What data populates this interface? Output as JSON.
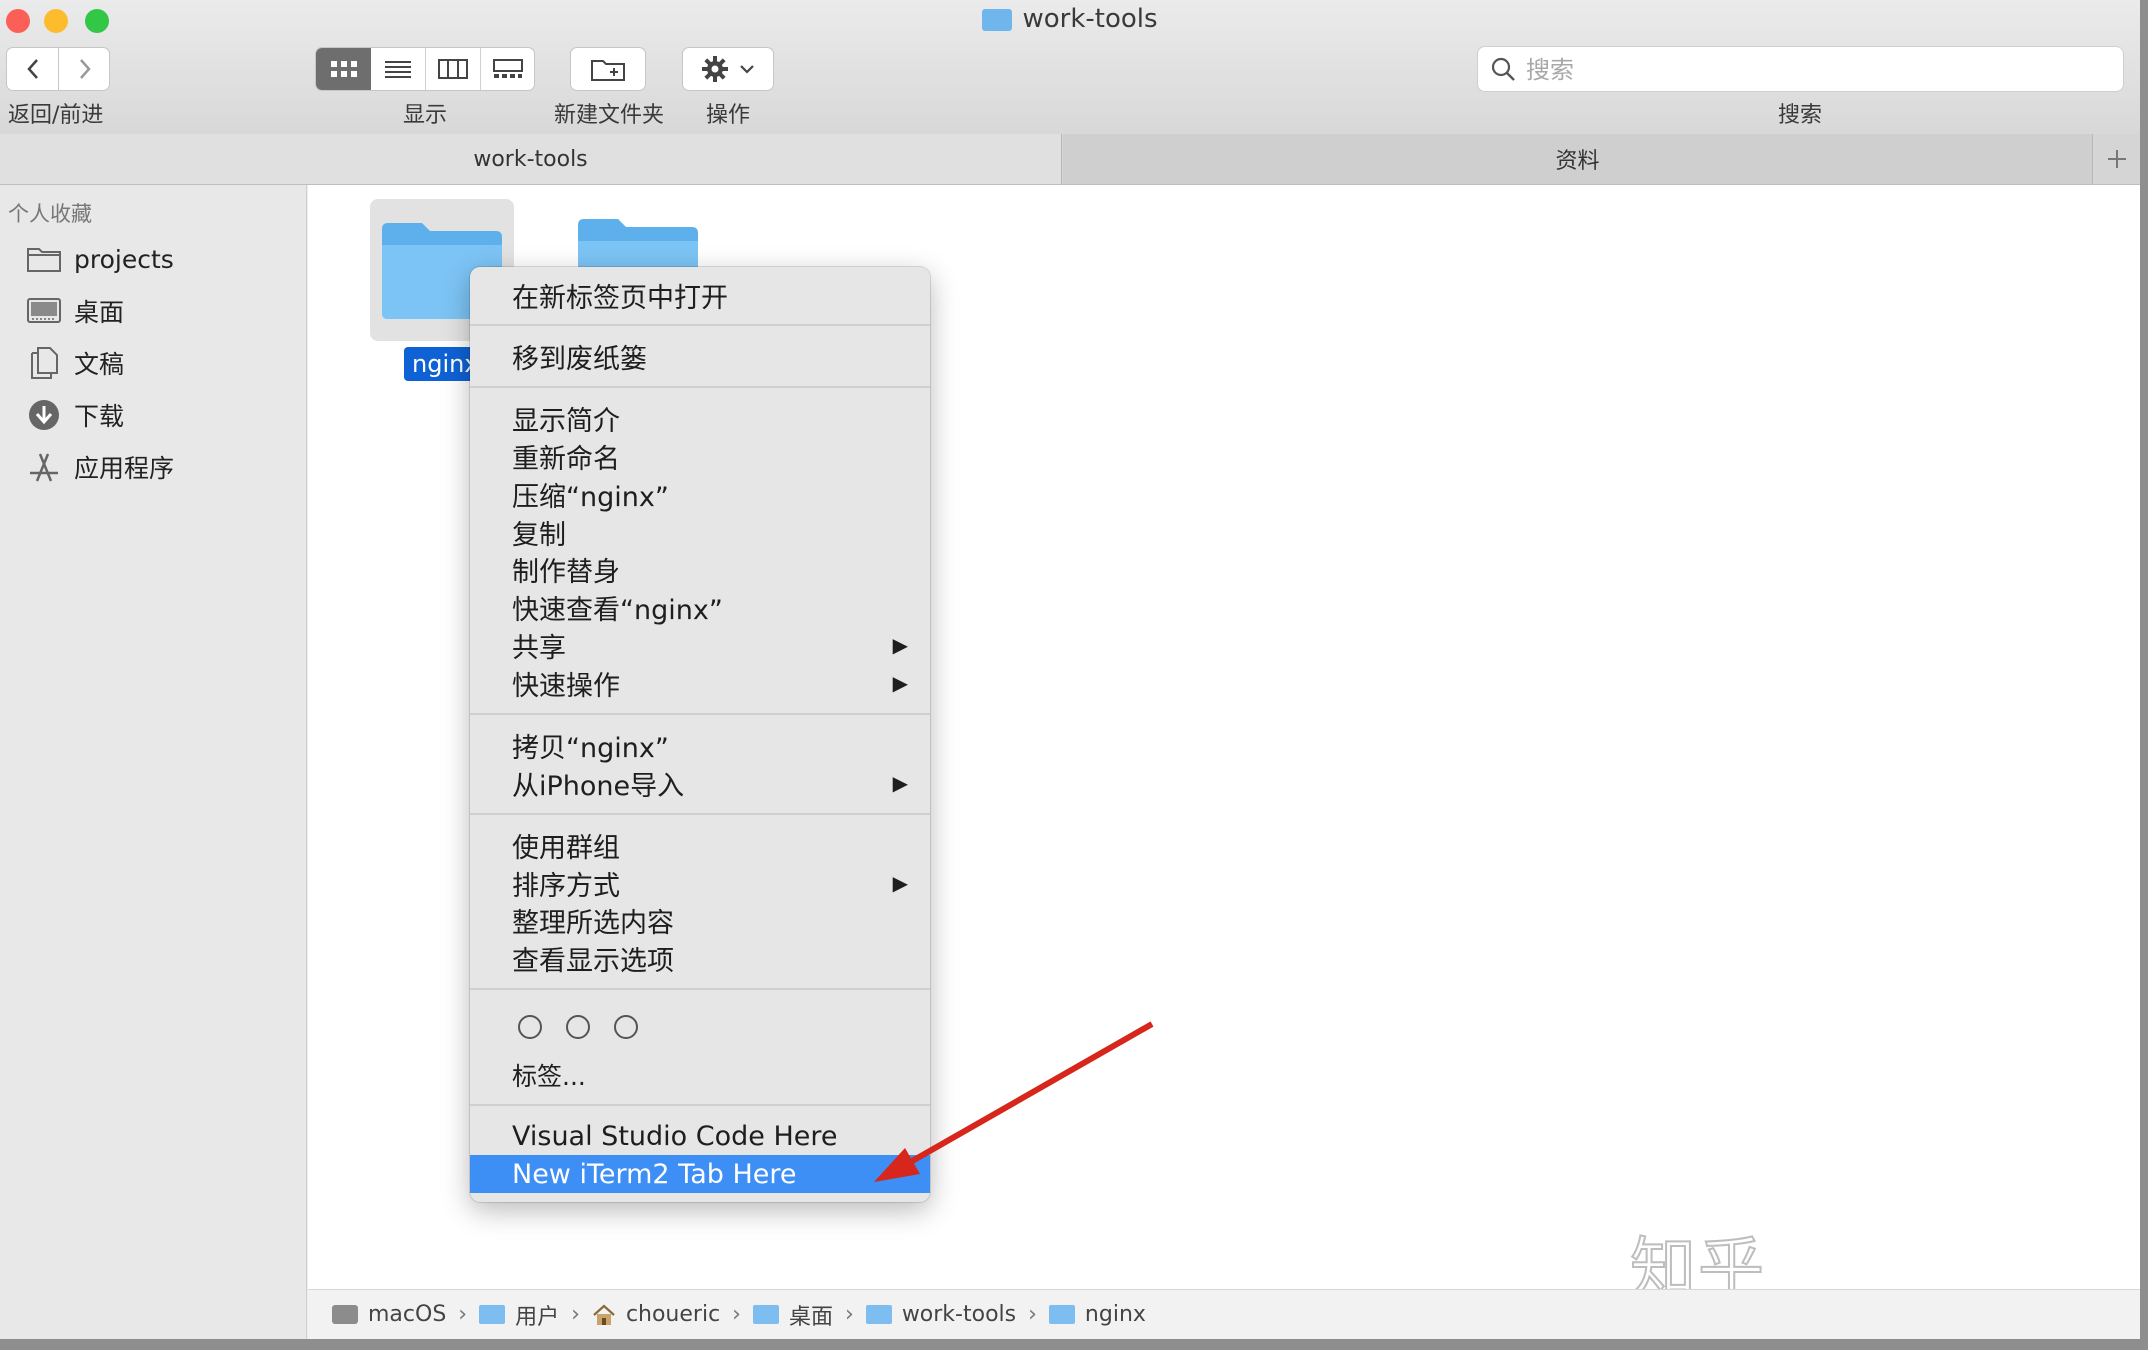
{
  "window": {
    "title": "work-tools",
    "traffic_lights": {
      "close": "#fc5f57",
      "minimize": "#fdbc2e",
      "zoom": "#33c748"
    }
  },
  "toolbar": {
    "back_forward_label": "返回/前进",
    "view_label": "显示",
    "new_folder_label": "新建文件夹",
    "action_label": "操作",
    "search_label": "搜索",
    "search_placeholder": "搜索"
  },
  "tabs": [
    {
      "label": "work-tools",
      "active": true
    },
    {
      "label": "资料",
      "active": false
    }
  ],
  "sidebar": {
    "section_title": "个人收藏",
    "items": [
      {
        "label": "projects",
        "icon": "folder-icon"
      },
      {
        "label": "桌面",
        "icon": "desktop-icon"
      },
      {
        "label": "文稿",
        "icon": "document-icon"
      },
      {
        "label": "下载",
        "icon": "download-icon"
      },
      {
        "label": "应用程序",
        "icon": "applications-icon"
      }
    ]
  },
  "content": {
    "selected_item": "nginx"
  },
  "context_menu": {
    "items": [
      {
        "label": "在新标签页中打开"
      },
      {
        "label": "移到废纸篓"
      },
      {
        "label": "显示简介"
      },
      {
        "label": "重新命名"
      },
      {
        "label": "压缩“nginx”"
      },
      {
        "label": "复制"
      },
      {
        "label": "制作替身"
      },
      {
        "label": "快速查看“nginx”"
      },
      {
        "label": "共享",
        "submenu": true
      },
      {
        "label": "快速操作",
        "submenu": true
      },
      {
        "label": "拷贝“nginx”"
      },
      {
        "label": "从iPhone导入",
        "submenu": true
      },
      {
        "label": "使用群组"
      },
      {
        "label": "排序方式",
        "submenu": true
      },
      {
        "label": "整理所选内容"
      },
      {
        "label": "查看显示选项"
      },
      {
        "label": "标签..."
      },
      {
        "label": "Visual Studio Code Here"
      },
      {
        "label": "New iTerm2 Tab Here",
        "highlighted": true
      }
    ],
    "submenu_arrow": "▶",
    "highlight_color": "#3d8ef5"
  },
  "path_bar": {
    "crumbs": [
      {
        "label": "macOS",
        "icon": "disk-icon"
      },
      {
        "label": "用户",
        "icon": "folder-icon"
      },
      {
        "label": "choueric",
        "icon": "home-icon"
      },
      {
        "label": "桌面",
        "icon": "folder-icon"
      },
      {
        "label": "work-tools",
        "icon": "folder-icon"
      },
      {
        "label": "nginx",
        "icon": "folder-icon"
      }
    ],
    "separator": "›"
  },
  "watermark": "知乎 @choueric",
  "annotation": {
    "arrow_color": "#d7261c"
  }
}
